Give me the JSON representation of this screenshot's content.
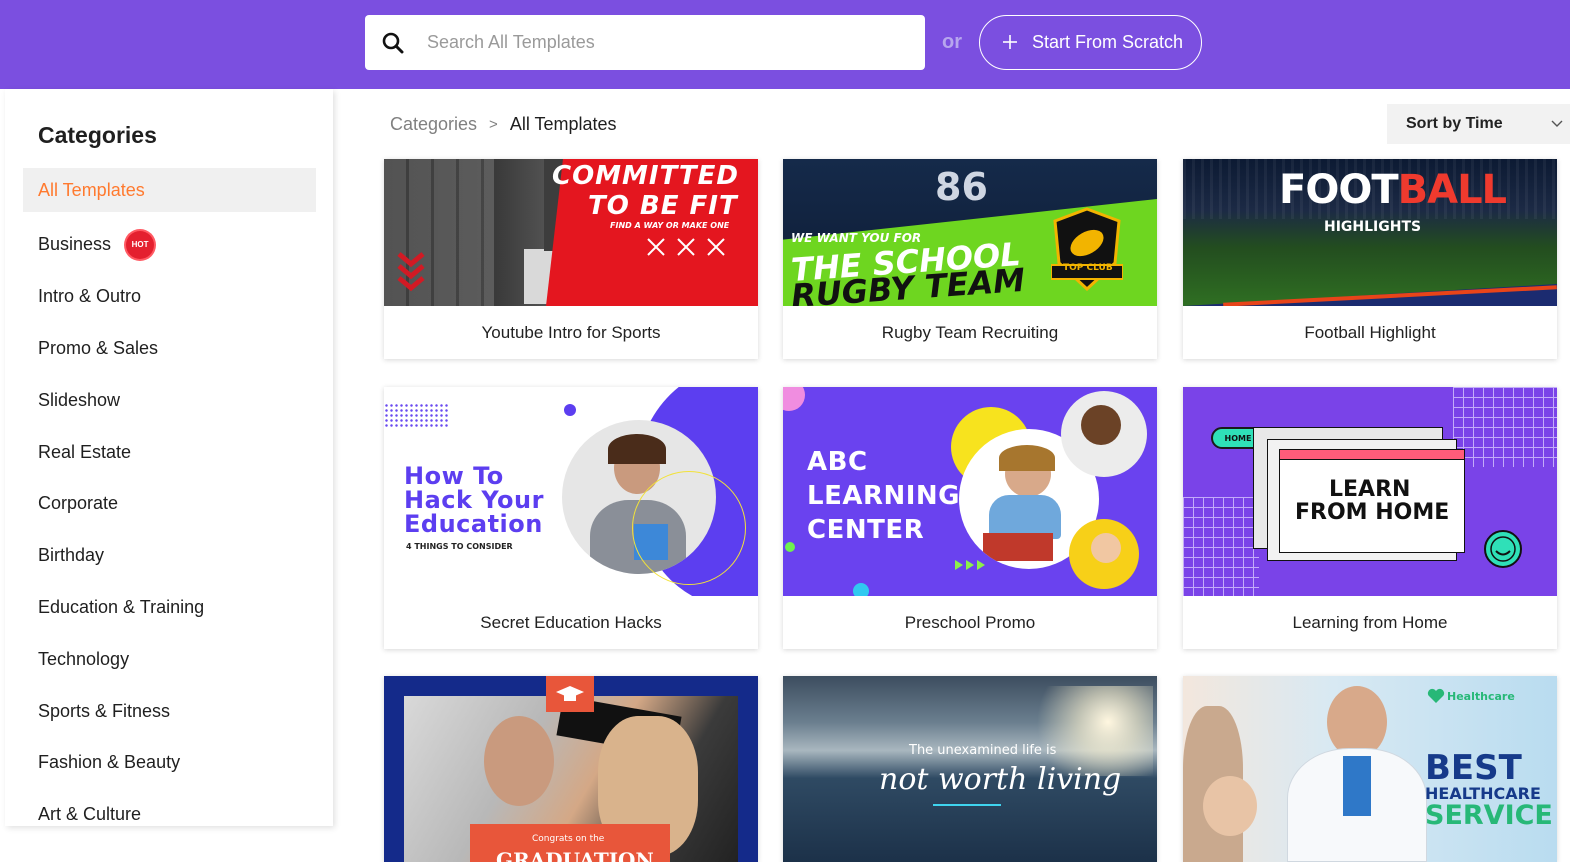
{
  "header": {
    "search_placeholder": "Search All Templates",
    "or_label": "or",
    "scratch_label": "Start From Scratch",
    "accent_color": "#7b4fe0"
  },
  "sidebar": {
    "title": "Categories",
    "items": [
      {
        "label": "All Templates",
        "active": true
      },
      {
        "label": "Business",
        "badge": "HOT"
      },
      {
        "label": "Intro & Outro"
      },
      {
        "label": "Promo & Sales"
      },
      {
        "label": "Slideshow"
      },
      {
        "label": "Real Estate"
      },
      {
        "label": "Corporate"
      },
      {
        "label": "Birthday"
      },
      {
        "label": "Education & Training"
      },
      {
        "label": "Technology"
      },
      {
        "label": "Sports & Fitness"
      },
      {
        "label": "Fashion & Beauty"
      },
      {
        "label": "Art & Culture"
      }
    ]
  },
  "breadcrumb": {
    "root": "Categories",
    "separator": ">",
    "current": "All Templates"
  },
  "sort": {
    "label": "Sort by Time"
  },
  "templates": [
    {
      "title": "Youtube Intro for Sports",
      "thumb_text": [
        "COMMITTED",
        "TO BE FIT",
        "FIND A WAY OR MAKE ONE"
      ]
    },
    {
      "title": "Rugby Team Recruiting",
      "thumb_text": [
        "86",
        "WE WANT YOU FOR",
        "THE SCHOOL",
        "RUGBY TEAM",
        "TOP CLUB"
      ]
    },
    {
      "title": "Football Highlight",
      "thumb_text": [
        "FOOTBALL",
        "HIGHLIGHTS"
      ]
    },
    {
      "title": "Secret Education Hacks",
      "thumb_text": [
        "How To",
        "Hack Your",
        "Education",
        "4 THINGS TO CONSIDER"
      ]
    },
    {
      "title": "Preschool Promo",
      "thumb_text": [
        "ABC",
        "LEARNING",
        "CENTER"
      ]
    },
    {
      "title": "Learning from Home",
      "thumb_text": [
        "HOME",
        "LEARN",
        "FROM HOME"
      ]
    },
    {
      "title": "",
      "thumb_text": [
        "Congrats on the",
        "GRADUATION"
      ]
    },
    {
      "title": "",
      "thumb_text": [
        "The unexamined life is",
        "not worth living"
      ]
    },
    {
      "title": "",
      "thumb_text": [
        "Healthcare",
        "BEST",
        "HEALTHCARE",
        "SERVICE"
      ]
    }
  ]
}
